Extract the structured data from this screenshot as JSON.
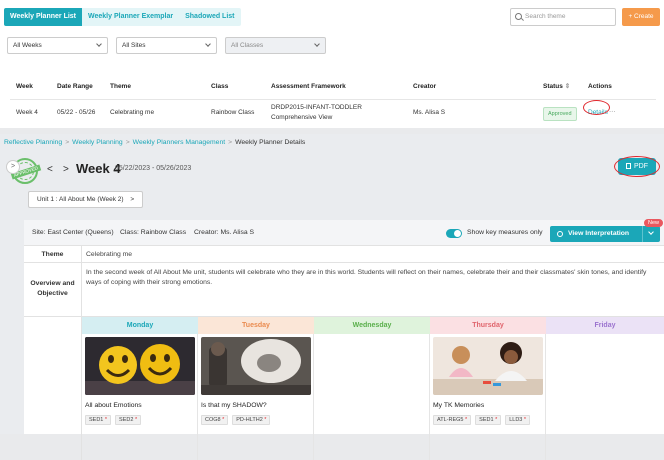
{
  "tabs": [
    "Weekly Planner List",
    "Weekly Planner Exemplar",
    "Shadowed List"
  ],
  "search": {
    "placeholder": "Search theme"
  },
  "create_label": "+ Create",
  "filters": {
    "weeks": "All Weeks",
    "sites": "All Sites",
    "classes": "All Classes"
  },
  "table": {
    "headers": [
      "Week",
      "Date Range",
      "Theme",
      "Class",
      "Assessment Framework",
      "Creator",
      "Status",
      "Actions"
    ],
    "sort_glyph": "⇕",
    "row": {
      "week": "Week 4",
      "date_range": "05/22 - 05/26",
      "theme": "Celebrating me",
      "class": "Rainbow Class",
      "framework": "DRDP2015-INFANT-TODDLER Comprehensive View",
      "creator": "Ms. Alisa S",
      "status": "Approved",
      "action": "Details",
      "more": "···"
    }
  },
  "breadcrumb": [
    "Reflective Planning",
    "Weekly Planning",
    "Weekly Planners Management",
    "Weekly Planner Details"
  ],
  "breadcrumb_sep": ">",
  "stamp_text": "APPROVED",
  "nav": {
    "prev": "<",
    "next": ">",
    "side": ">"
  },
  "week_title": "Week 4",
  "week_dates": "05/22/2023 - 05/26/2023",
  "pdf_label": "PDF",
  "unit_label": "Unit 1 : All About Me (Week 2)",
  "unit_arrow": ">",
  "info": {
    "site": "Site: East Center (Queens)",
    "class": "Class: Rainbow Class",
    "creator": "Creator: Ms. Alisa S",
    "key_measures": "Show key measures only",
    "view_interpretation": "View Interpretation",
    "new_badge": "New"
  },
  "theme": {
    "label": "Theme",
    "value": "Celebrating me"
  },
  "overview": {
    "label": "Overview and Objective",
    "text": "In the second week of All About Me unit, students will celebrate who they are in this world. Students will reflect on their names, celebrate their and their classmates' skin tones, and identify ways of coping with their strong emotions."
  },
  "days": [
    {
      "name": "Monday",
      "bg": "#d5eef2",
      "color": "#1ba7b8"
    },
    {
      "name": "Tuesday",
      "bg": "#fbe6d7",
      "color": "#ea8b4f"
    },
    {
      "name": "Wednesday",
      "bg": "#dff3dc",
      "color": "#5aaf4b"
    },
    {
      "name": "Thursday",
      "bg": "#fbe0e3",
      "color": "#e0646c"
    },
    {
      "name": "Friday",
      "bg": "#ebe2f6",
      "color": "#9b73cf"
    }
  ],
  "cards": {
    "monday": {
      "title": "All about Emotions",
      "tags": [
        "SED1",
        "SED2"
      ]
    },
    "tuesday": {
      "title": "Is that my SHADOW?",
      "tags": [
        "COG8",
        "PD-HLTH2"
      ]
    },
    "thursday": {
      "title": "My TK Memories",
      "tags": [
        "ATL-REG5",
        "SED1",
        "LLD3"
      ]
    }
  },
  "tag_star": "*"
}
